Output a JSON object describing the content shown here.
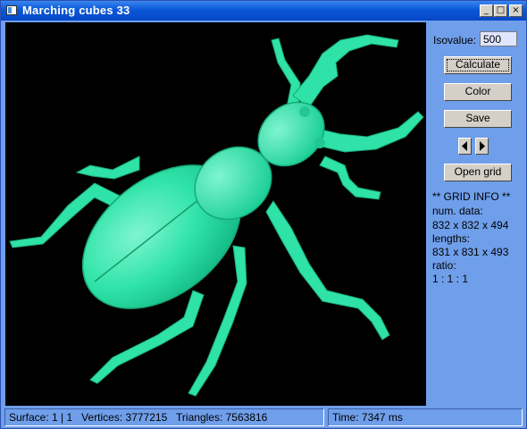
{
  "window": {
    "title": "Marching cubes 33"
  },
  "titlebar_buttons": {
    "minimize": "_",
    "maximize": "□",
    "close": "×"
  },
  "panel": {
    "isovalue_label": "Isovalue:",
    "isovalue_value": "500",
    "buttons": {
      "calculate": "Calculate",
      "color": "Color",
      "save": "Save",
      "open_grid": "Open grid"
    },
    "grid_info": {
      "header": "** GRID  INFO **",
      "num_data_label": "num. data:",
      "num_data_value": "832 x 832 x 494",
      "lengths_label": "lengths:",
      "lengths_value": "831 x 831 x 493",
      "ratio_label": "ratio:",
      "ratio_value": "1 : 1 : 1"
    }
  },
  "status": {
    "surface": "Surface: 1 | 1",
    "vertices": "Vertices: 3777215",
    "triangles": "Triangles: 7563816",
    "time": "Time: 7347 ms"
  },
  "colors": {
    "surface": "#2fe3a8",
    "viewport_bg": "#000000",
    "window_bg": "#6f9eea",
    "titlebar": "#0a58d8"
  },
  "icons": [
    "app-icon",
    "minimize-icon",
    "maximize-icon",
    "close-icon",
    "arrow-left-icon",
    "arrow-right-icon"
  ]
}
